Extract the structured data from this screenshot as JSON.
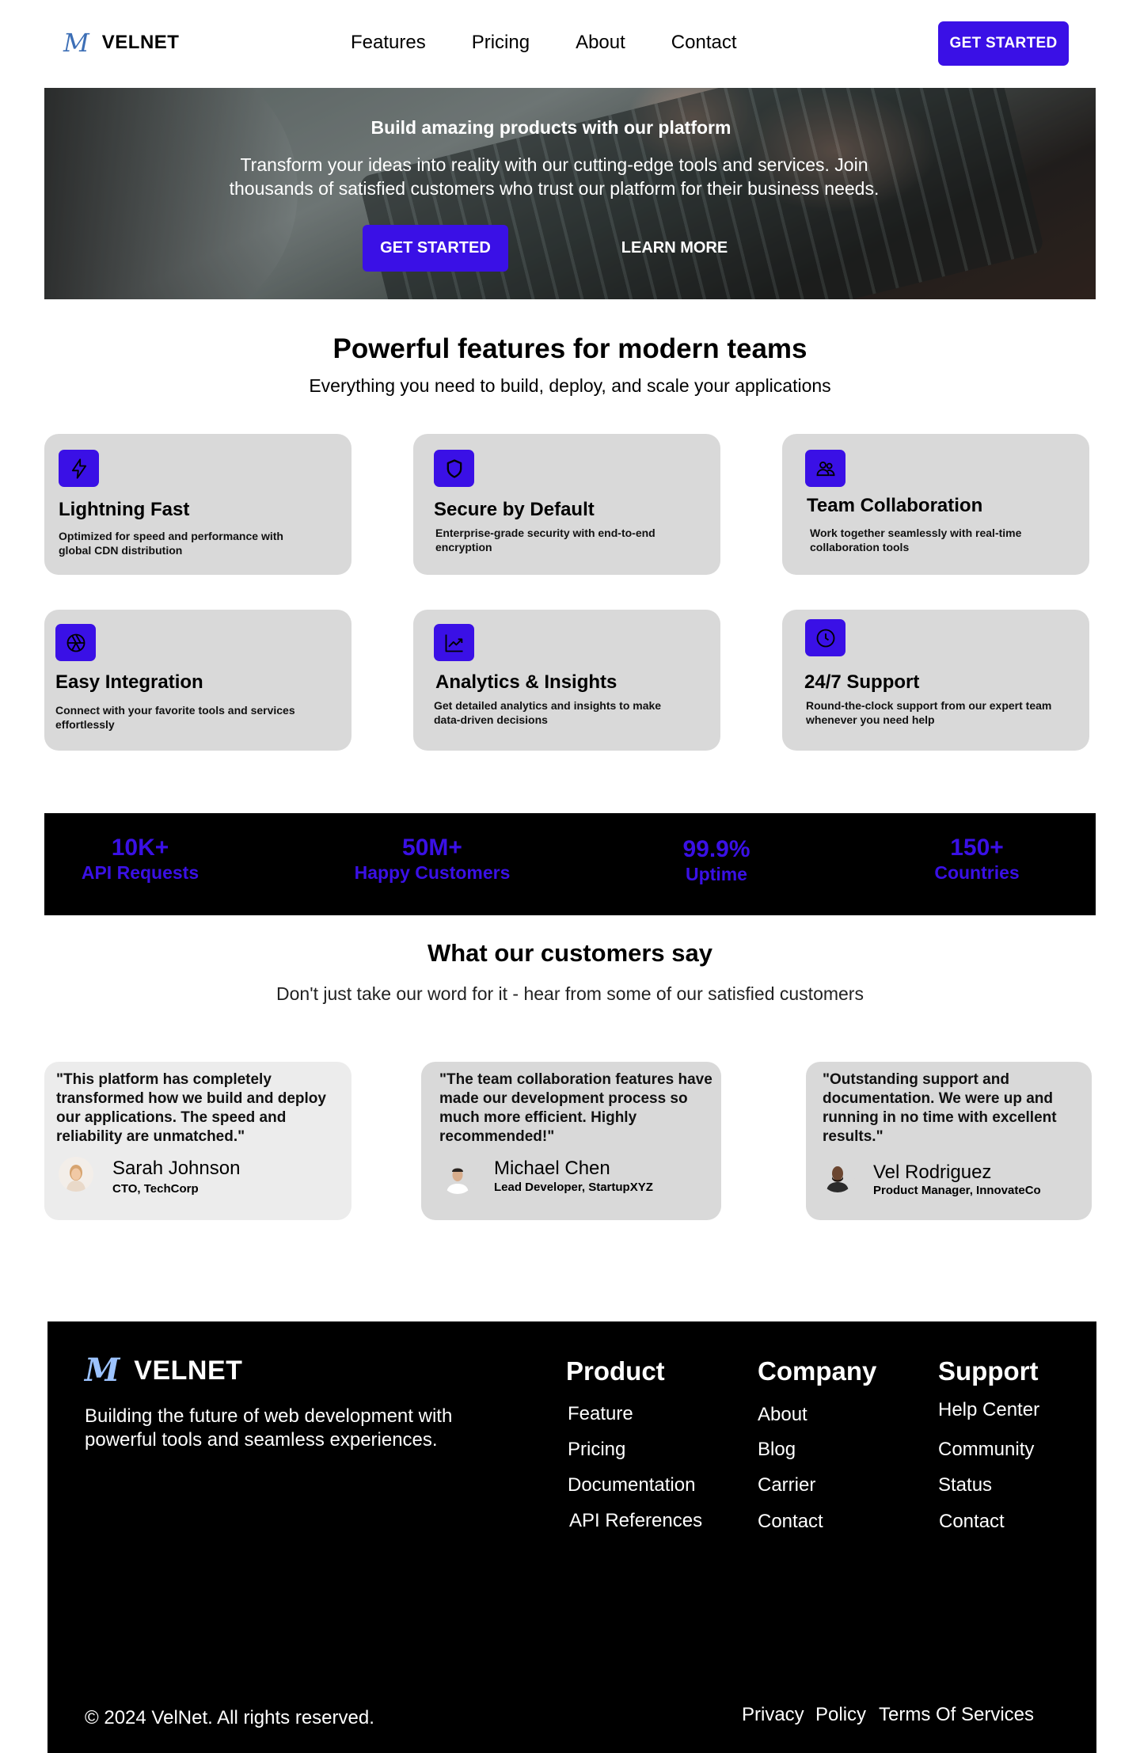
{
  "nav": {
    "logo_mark": "M",
    "logo_text": "VELNET",
    "links": [
      "Features",
      "Pricing",
      "About",
      "Contact"
    ],
    "cta": "GET STARTED"
  },
  "hero": {
    "title": "Build amazing products with our platform",
    "subtitle": "Transform your ideas into reality with our cutting-edge tools and services. Join thousands of satisfied customers who trust our platform for their business needs.",
    "primary_button": "GET STARTED",
    "secondary_button": "LEARN MORE"
  },
  "features": {
    "title": "Powerful features for modern teams",
    "subtitle": "Everything you need to build, deploy, and scale your applications",
    "items": [
      {
        "icon": "lightning-icon",
        "title": "Lightning Fast",
        "desc": "Optimized for speed and performance with global CDN distribution"
      },
      {
        "icon": "shield-icon",
        "title": "Secure by Default",
        "desc": "Enterprise-grade security with end-to-end encryption"
      },
      {
        "icon": "users-icon",
        "title": "Team Collaboration",
        "desc": "Work together seamlessly with real-time collaboration tools"
      },
      {
        "icon": "aperture-icon",
        "title": "Easy Integration",
        "desc": "Connect with your favorite tools and services effortlessly"
      },
      {
        "icon": "chart-icon",
        "title": "Analytics & Insights",
        "desc": "Get detailed analytics and insights to make data-driven decisions"
      },
      {
        "icon": "clock-icon",
        "title": "24/7 Support",
        "desc": "Round-the-clock support from our expert team whenever you need help"
      }
    ],
    "icon_color": "#3a10e6",
    "card_color": "#d9d9d9"
  },
  "stats": [
    {
      "value": "10K+",
      "label": "API Requests"
    },
    {
      "value": "50M+",
      "label": "Happy Customers"
    },
    {
      "value": "99.9%",
      "label": "Uptime"
    },
    {
      "value": "150+",
      "label": "Countries"
    }
  ],
  "testimonials": {
    "title": "What our customers say",
    "subtitle": "Don't just take our word for it - hear from some of our satisfied customers",
    "items": [
      {
        "quote": "\"This platform has completely transformed how we build and deploy our applications. The speed and reliability are unmatched.\"",
        "name": "Sarah Johnson",
        "role": "CTO, TechCorp"
      },
      {
        "quote": "\"The team collaboration features have made our development process so much more efficient. Highly recommended!\"",
        "name": "Michael Chen",
        "role": "Lead Developer, StartupXYZ"
      },
      {
        "quote": "\"Outstanding support and documentation. We were up and running in no time with excellent results.\"",
        "name": "Vel Rodriguez",
        "role": "Product Manager, InnovateCo"
      }
    ]
  },
  "footer": {
    "logo_mark": "M",
    "logo_text": "VELNET",
    "tagline": "Building the future of web development with powerful tools and seamless experiences.",
    "columns": [
      {
        "title": "Product",
        "links": [
          "Feature",
          "Pricing",
          "Documentation",
          "API References"
        ]
      },
      {
        "title": "Company",
        "links": [
          "About",
          "Blog",
          "Carrier",
          "Contact"
        ]
      },
      {
        "title": "Support",
        "links": [
          "Help Center",
          "Community",
          "Status",
          "Contact"
        ]
      }
    ],
    "copyright": "© 2024 VelNet. All rights reserved.",
    "legal": [
      "Privacy",
      "Policy",
      "Terms Of Services"
    ]
  },
  "colors": {
    "accent": "#3a10e6",
    "footer_bg": "#000000",
    "stats_bg": "#000000"
  }
}
